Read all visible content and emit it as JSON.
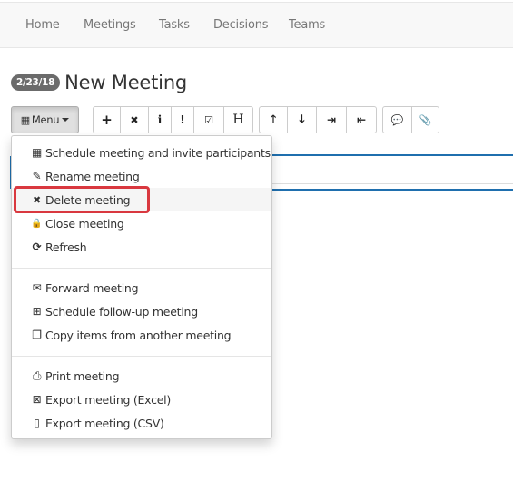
{
  "nav": {
    "items": [
      {
        "label": "Home"
      },
      {
        "label": "Meetings"
      },
      {
        "label": "Tasks"
      },
      {
        "label": "Decisions"
      },
      {
        "label": "Teams"
      }
    ]
  },
  "header": {
    "date_badge": "2/23/18",
    "title": "New Meeting"
  },
  "toolbar": {
    "menu_label": "Menu",
    "group1": [
      {
        "name": "add-item",
        "glyph": "+"
      },
      {
        "name": "delete-item",
        "glyph": "✖"
      },
      {
        "name": "info-item",
        "glyph": "i"
      },
      {
        "name": "important-item",
        "glyph": "!"
      },
      {
        "name": "task-item",
        "glyph": "☑"
      },
      {
        "name": "heading-item",
        "glyph": "H"
      }
    ],
    "group2": [
      {
        "name": "move-up",
        "glyph": "🡑"
      },
      {
        "name": "move-down",
        "glyph": "🡓"
      },
      {
        "name": "indent",
        "glyph": "⇥"
      },
      {
        "name": "outdent",
        "glyph": "⇤"
      }
    ],
    "group3": [
      {
        "name": "comment",
        "glyph": "💬"
      },
      {
        "name": "attach",
        "glyph": "📎"
      }
    ]
  },
  "dropdown": {
    "items": [
      {
        "label": "Schedule meeting and invite participants",
        "icon": "calendar-icon",
        "glyph": "▦"
      },
      {
        "label": "Rename meeting",
        "icon": "edit-icon",
        "glyph": "✎"
      },
      {
        "label": "Delete meeting",
        "icon": "close-icon",
        "glyph": "✖",
        "highlighted": true
      },
      {
        "label": "Close meeting",
        "icon": "lock-icon",
        "glyph": "🔒"
      },
      {
        "label": "Refresh",
        "icon": "refresh-icon",
        "glyph": "⟳"
      },
      {
        "label": "Forward meeting",
        "icon": "envelope-icon",
        "glyph": "✉"
      },
      {
        "label": "Schedule follow-up meeting",
        "icon": "calendar-plus-icon",
        "glyph": "⊞"
      },
      {
        "label": "Copy items from another meeting",
        "icon": "copy-icon",
        "glyph": "❐"
      },
      {
        "label": "Print meeting",
        "icon": "print-icon",
        "glyph": "⎙"
      },
      {
        "label": "Export meeting (Excel)",
        "icon": "excel-file-icon",
        "glyph": "⊠"
      },
      {
        "label": "Export meeting (CSV)",
        "icon": "file-icon",
        "glyph": "▯"
      }
    ]
  },
  "colors": {
    "accent_blue": "#1f6fae",
    "highlight_red": "#d9383f",
    "badge_grey": "#6b6b6b"
  }
}
